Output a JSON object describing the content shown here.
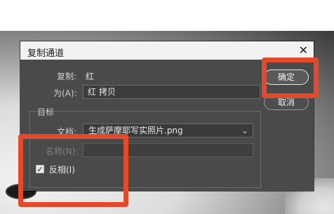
{
  "colors": {
    "annotation_red": "#e24a2b",
    "dialog_bg": "#4a4a4a",
    "titlebar_bg": "#f2f2f2"
  },
  "dialog": {
    "title": "复制通道",
    "close_icon": "close-icon",
    "labels": {
      "copy": "复制:",
      "as": "为(A):",
      "target_group": "目标",
      "document": "文档:",
      "name": "名称(N):",
      "invert": "反相(I)"
    },
    "values": {
      "copy_channel": "红",
      "as_name": "红 拷贝",
      "document_selected": "生成萨摩耶写实照片.png",
      "name_value": "",
      "invert_checked": true
    },
    "buttons": {
      "ok": "确定",
      "cancel": "取消"
    }
  }
}
